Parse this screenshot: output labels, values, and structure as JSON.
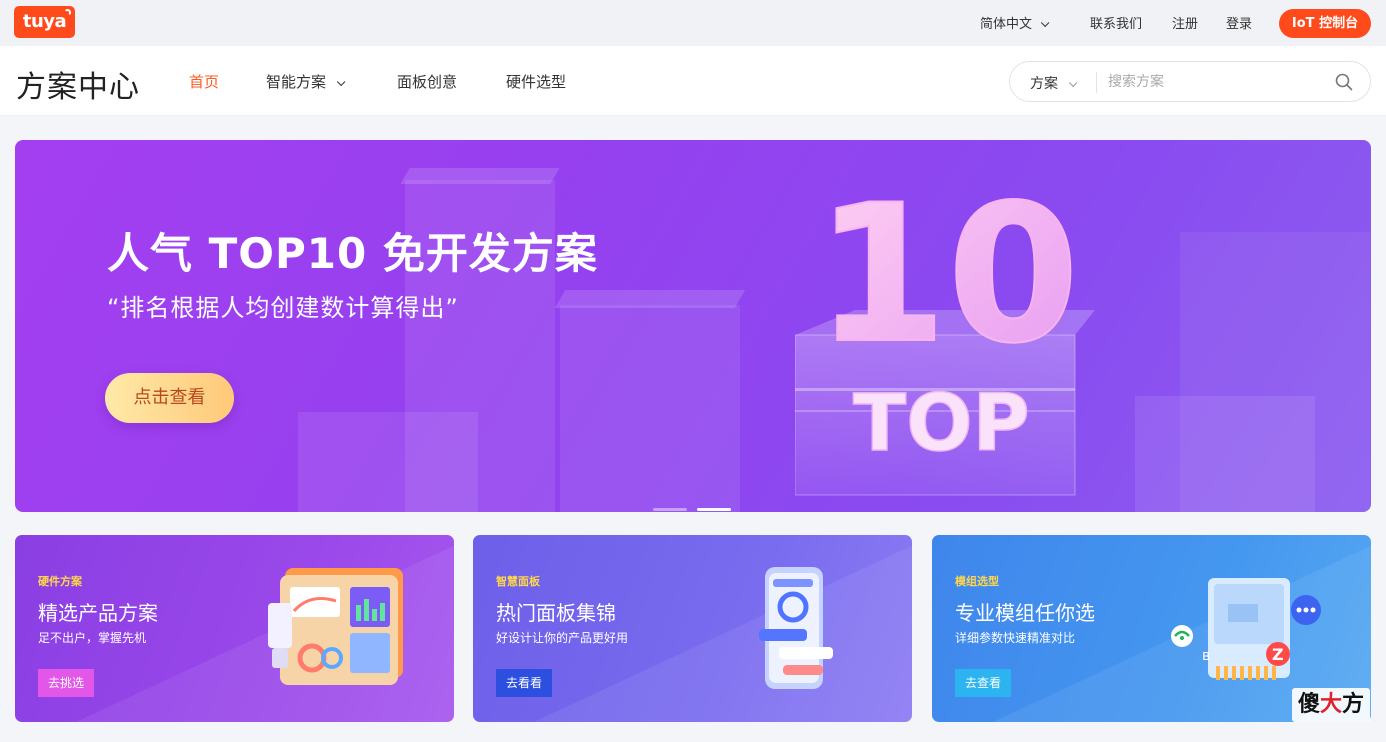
{
  "topbar": {
    "logo_text": "tuya",
    "language": "简体中文",
    "contact": "联系我们",
    "register": "注册",
    "login": "登录",
    "console_button": "IoT 控制台"
  },
  "navbar": {
    "brand": "方案中心",
    "items": [
      {
        "label": "首页",
        "active": true
      },
      {
        "label": "智能方案",
        "dropdown": true
      },
      {
        "label": "面板创意"
      },
      {
        "label": "硬件选型"
      }
    ],
    "search": {
      "category": "方案",
      "placeholder": "搜索方案"
    }
  },
  "hero": {
    "title": "人气 TOP10 免开发方案",
    "subtitle": "“排名根据人均创建数计算得出”",
    "cta": "点击查看",
    "art_number": "10",
    "art_word": "TOP",
    "slides": 2,
    "active_slide": 2
  },
  "cards": [
    {
      "tag": "硬件方案",
      "title": "精选产品方案",
      "desc": "足不出户，掌握先机",
      "button": "去挑选",
      "button_color": "#e357e8"
    },
    {
      "tag": "智慧面板",
      "title": "热门面板集锦",
      "desc": "好设计让你的产品更好用",
      "button": "去看看",
      "button_color": "#2c4fe0"
    },
    {
      "tag": "模组选型",
      "title": "专业模组任你选",
      "desc": "详细参数快速精准对比",
      "button": "去查看",
      "button_color": "#2bb4f0"
    }
  ],
  "watermark": "傻大方",
  "colors": {
    "brand_orange": "#ff4a1c",
    "active_nav": "#ff5a1f",
    "hero_purple": "#9a40ef"
  }
}
